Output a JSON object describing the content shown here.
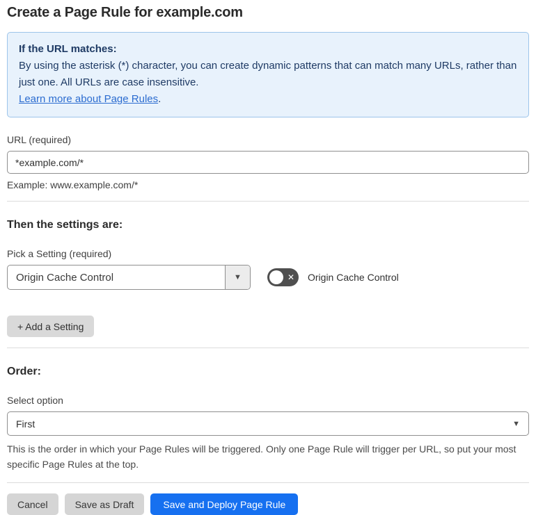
{
  "page": {
    "title": "Create a Page Rule for example.com"
  },
  "info_box": {
    "heading": "If the URL matches:",
    "body": "By using the asterisk (*) character, you can create dynamic patterns that can match many URLs, rather than just one. All URLs are case insensitive.",
    "link_label": "Learn more about Page Rules",
    "link_suffix": "."
  },
  "url_field": {
    "label": "URL (required)",
    "value": "*example.com/*",
    "helper": "Example: www.example.com/*"
  },
  "settings_section": {
    "heading": "Then the settings are:",
    "picker_label": "Pick a Setting (required)",
    "picker_value": "Origin Cache Control",
    "toggle_label": "Origin Cache Control",
    "toggle_state": "off",
    "add_button_label": "+ Add a Setting"
  },
  "order_section": {
    "heading": "Order:",
    "select_label": "Select option",
    "select_value": "First",
    "helper": "This is the order in which your Page Rules will be triggered. Only one Page Rule will trigger per URL, so put your most specific Page Rules at the top."
  },
  "footer": {
    "cancel_label": "Cancel",
    "save_draft_label": "Save as Draft",
    "save_deploy_label": "Save and Deploy Page Rule"
  },
  "icons": {
    "caret_down": "▼",
    "toggle_x": "✕"
  },
  "colors": {
    "accent_blue": "#1670f0",
    "info_bg": "#e8f2fc",
    "info_border": "#9cc4ea",
    "info_text": "#1e3a64",
    "link_blue": "#2b6cd0",
    "toggle_off_bg": "#4f4f4f",
    "button_gray": "#d5d5d5",
    "divider": "#dcdcdc"
  }
}
